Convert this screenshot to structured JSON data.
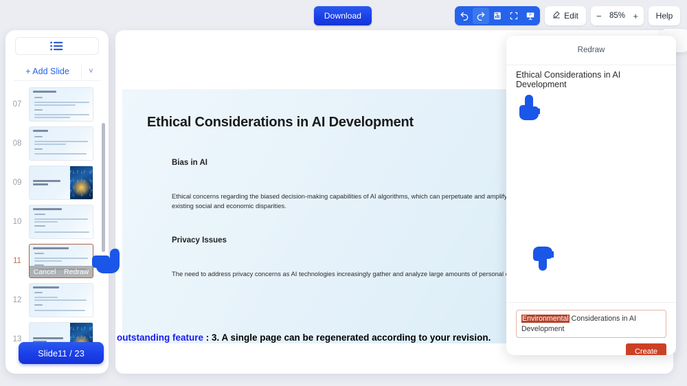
{
  "topbar": {
    "download_label": "Download",
    "edit_label": "Edit",
    "zoom_minus": "−",
    "zoom_value": "85%",
    "zoom_plus": "+",
    "help_label": "Help",
    "icons": [
      "undo-icon",
      "redo-icon",
      "slide-list-icon",
      "fit-screen-icon",
      "present-icon"
    ],
    "accent_blue": "#2563eb",
    "download_blue": "#1a3fe8"
  },
  "sidebar": {
    "list_toggle_icon": "list-view-icon",
    "add_slide_label": "+ Add Slide",
    "add_slide_caret": "˅",
    "counter_label": "Slide11 / 23",
    "slides": [
      {
        "num": "07",
        "title": "Early Beginnings",
        "has_image": false,
        "selected": false
      },
      {
        "num": "08",
        "title": "AI Winters",
        "has_image": false,
        "selected": false
      },
      {
        "num": "09",
        "title": "AI in Recent Decade: its Resurgence and Applications",
        "has_image": true,
        "selected": false
      },
      {
        "num": "10",
        "title": "Advancements in AI Algorithms",
        "has_image": false,
        "selected": false
      },
      {
        "num": "11",
        "title": "Ethical Considerations in AI Development",
        "has_image": false,
        "selected": true
      },
      {
        "num": "12",
        "title": "Industry Applications of AI",
        "has_image": false,
        "selected": false
      },
      {
        "num": "13",
        "title": "AI in Ethical Considerations in AI Development",
        "has_image": true,
        "selected": false
      }
    ],
    "overlay": {
      "cancel_label": "Cancel",
      "redraw_label": "Redraw"
    }
  },
  "slide": {
    "title": "Ethical Considerations in AI Development",
    "sections": [
      {
        "heading": "Bias in AI",
        "body": "Ethical concerns regarding the biased decision-making capabilities of AI algorithms, which can perpetuate and amplify existing social and economic disparities."
      },
      {
        "heading": "Privacy Issues",
        "body": "The need to address privacy concerns as AI technologies increasingly gather and analyze large amounts of personal data."
      }
    ]
  },
  "caption": {
    "highlight": "outstanding feature",
    "rest": " : 3. A single page can be regenerated according to your revision.",
    "highlight_color": "#1a1af0"
  },
  "redraw_panel": {
    "header": "Redraw",
    "subject": "Ethical Considerations in AI Development",
    "prompt_highlight": "Environmental",
    "prompt_rest": " Considerations in AI Development",
    "create_label": "Create",
    "create_color": "#cc4125"
  }
}
